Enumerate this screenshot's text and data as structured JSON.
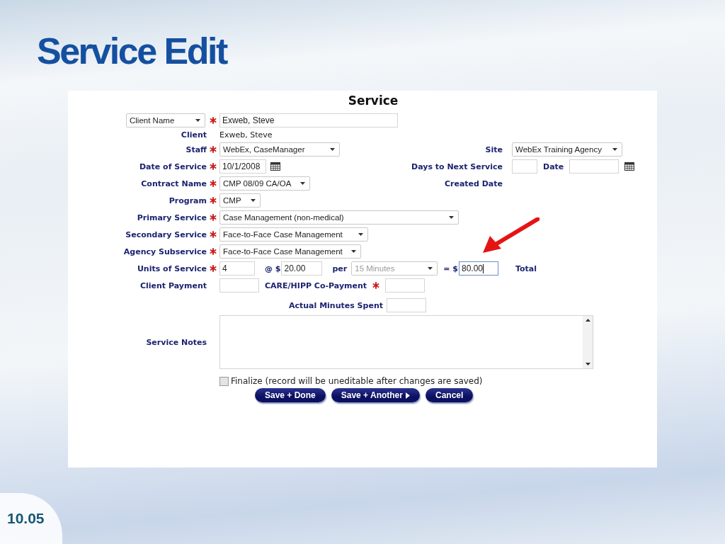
{
  "slide": {
    "title": "Service Edit",
    "page_number": "10.05"
  },
  "form": {
    "title": "Service",
    "search": {
      "field": "Client Name",
      "value": "Exweb, Steve",
      "required": true
    },
    "client": {
      "label": "Client",
      "value": "Exweb, Steve"
    },
    "rows": [
      {
        "kind": "field",
        "label": "Staff",
        "required": true,
        "input": {
          "kind": "select",
          "value": "WebEx, CaseManager"
        },
        "side": {
          "label": "Site",
          "inputs": [
            {
              "kind": "select",
              "value": "WebEx Training Agency"
            }
          ]
        }
      },
      {
        "kind": "field",
        "label": "Date of Service",
        "required": true,
        "input": {
          "kind": "date",
          "value": "10/1/2008"
        },
        "side": {
          "label": "Days to Next Service",
          "inputs": [
            {
              "kind": "text"
            },
            {
              "kind": "label",
              "label": "Date"
            },
            {
              "kind": "date"
            }
          ]
        }
      },
      {
        "kind": "field",
        "label": "Contract Name",
        "required": true,
        "input": {
          "kind": "select",
          "value": "CMP 08/09 CA/OA"
        },
        "side": {
          "label": "Created Date"
        }
      },
      {
        "kind": "field",
        "label": "Program",
        "required": true,
        "input": {
          "kind": "select",
          "value": "CMP"
        }
      },
      {
        "kind": "field",
        "label": "Primary Service",
        "required": true,
        "input": {
          "kind": "select",
          "value": "Case Management (non-medical)"
        }
      },
      {
        "kind": "field",
        "label": "Secondary Service",
        "required": true,
        "input": {
          "kind": "select",
          "value": "Face-to-Face Case Management"
        }
      },
      {
        "kind": "field",
        "label": "Agency Subservice",
        "required": true,
        "input": {
          "kind": "select",
          "value": "Face-to-Face Case Management"
        }
      },
      {
        "kind": "units",
        "label": "Units of Service",
        "required": true,
        "units": "4",
        "rate_label": "@ $",
        "rate": "20.00",
        "per_label": "per",
        "per": {
          "value": "15 Minutes",
          "disabled": true
        },
        "total_prefix": "= $",
        "total": {
          "value": "80.00",
          "focused": true
        },
        "total_label": "Total"
      },
      {
        "kind": "payment",
        "label": "Client Payment",
        "required": false,
        "copay": {
          "label": "CARE/HIPP Co-Payment",
          "required": true
        }
      },
      {
        "kind": "minutes",
        "label": "Actual Minutes Spent"
      },
      {
        "kind": "notes",
        "label": "Service Notes"
      }
    ],
    "finalize": {
      "label": "Finalize (record will be uneditable after changes are saved)",
      "checked": false
    },
    "buttons": [
      {
        "label": "Save + Done",
        "arrow": false
      },
      {
        "label": "Save + Another",
        "arrow": true
      },
      {
        "label": "Cancel",
        "arrow": false
      }
    ]
  }
}
